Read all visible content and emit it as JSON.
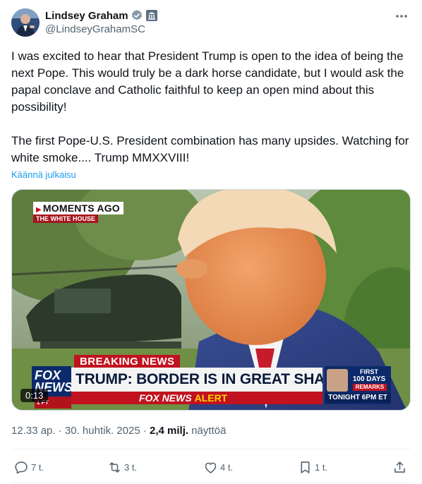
{
  "author": {
    "display_name": "Lindsey Graham",
    "handle": "@LindseyGrahamSC",
    "verified_color": "#829aab",
    "avatar_icon": "avatar-photo"
  },
  "tweet": {
    "paragraphs": [
      "I was excited to hear that President Trump is open to the idea of being the next Pope. This would truly be a dark horse candidate, but I would ask the papal conclave and Catholic faithful to keep an open mind about this possibility!",
      "The first Pope-U.S. President combination has many upsides. Watching for white smoke.... Trump MMXXVIII!"
    ],
    "translate_label": "Käännä julkaisu"
  },
  "video": {
    "moments_label": "MOMENTS AGO",
    "location_label": "THE WHITE HOUSE",
    "breaking_label": "BREAKING NEWS",
    "headline": "TRUMP: BORDER IS IN GREAT SHAPE",
    "alert_brand": "FOX NEWS",
    "alert_word": "ALERT",
    "logo_text": "FOX NEWS",
    "logo_sub": "1 PT",
    "promo_first": "FIRST",
    "promo_days": "100 DAYS",
    "promo_remarks": "REMARKS",
    "promo_time": "TONIGHT 6PM ET",
    "duration": "0:13"
  },
  "meta": {
    "time": "12.33 ap.",
    "separator": "·",
    "date": "30. huhtik. 2025",
    "views_count": "2,4 milj.",
    "views_label": "näyttöä"
  },
  "actions": {
    "reply_count": "7 t.",
    "repost_count": "3 t.",
    "like_count": "4 t.",
    "bookmark_count": "1 t."
  },
  "colors": {
    "link": "#1d9bf0",
    "muted": "#536471",
    "text": "#0f1419",
    "fox_red": "#c1121f",
    "fox_blue": "#0c2a6b"
  }
}
